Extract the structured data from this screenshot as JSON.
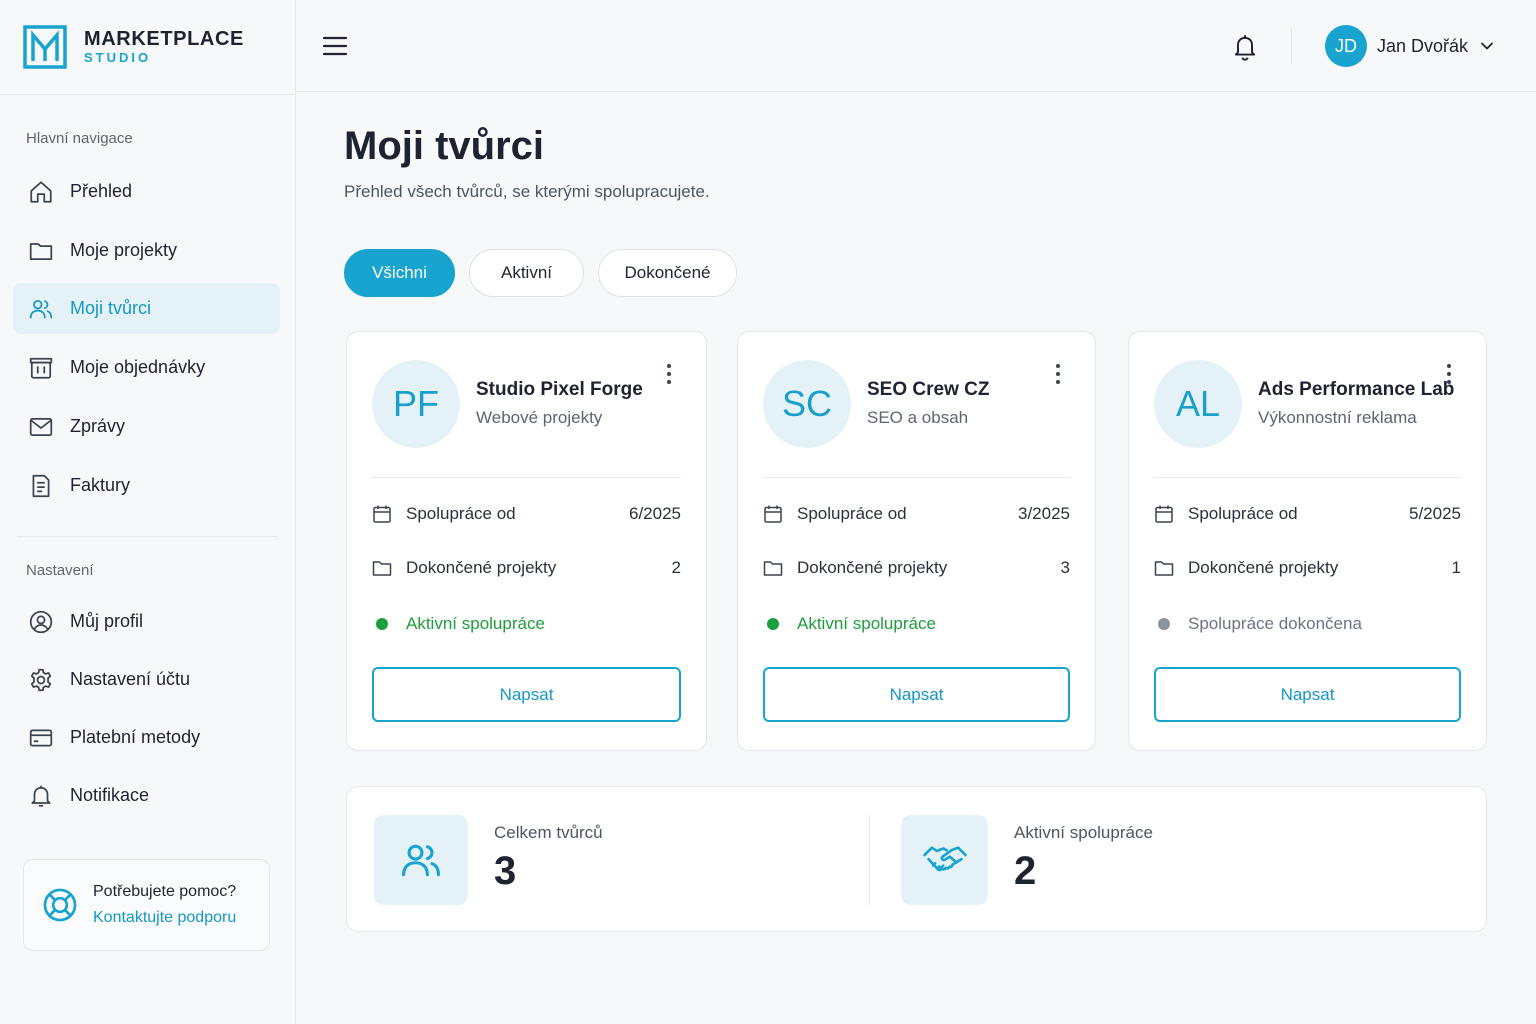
{
  "brand": {
    "title": "MARKETPLACE",
    "subtitle": "STUDIO",
    "accent": "#19a3cf"
  },
  "sidebar": {
    "section_main": "Hlavní navigace",
    "main_items": [
      {
        "label": "Přehled",
        "icon": "home-icon"
      },
      {
        "label": "Moje projekty",
        "icon": "folder-icon"
      },
      {
        "label": "Moji tvůrci",
        "icon": "users-icon",
        "active": true
      },
      {
        "label": "Moje objednávky",
        "icon": "shopping-bag-icon"
      },
      {
        "label": "Zprávy",
        "icon": "mail-icon"
      },
      {
        "label": "Faktury",
        "icon": "invoice-icon"
      }
    ],
    "section_settings": "Nastavení",
    "settings_items": [
      {
        "label": "Můj profil",
        "icon": "user-circle-icon"
      },
      {
        "label": "Nastavení účtu",
        "icon": "gear-icon"
      },
      {
        "label": "Platební metody",
        "icon": "credit-card-icon"
      },
      {
        "label": "Notifikace",
        "icon": "bell-icon"
      }
    ],
    "help": {
      "title": "Potřebujete pomoc?",
      "link": "Kontaktujte podporu",
      "icon": "lifebuoy-icon"
    }
  },
  "header": {
    "user": {
      "initials": "JD",
      "name": "Jan Dvořák"
    }
  },
  "main": {
    "title": "Moji tvůrci",
    "subtitle": "Přehled všech tvůrců, se kterými spolupracujete.",
    "filters": [
      {
        "label": "Všichni",
        "active": true
      },
      {
        "label": "Aktivní",
        "active": false
      },
      {
        "label": "Dokončené",
        "active": false
      }
    ],
    "creators": [
      {
        "initials": "PF",
        "name": "Studio Pixel Forge",
        "category": "Webové projekty",
        "since_label": "Spolupráce od",
        "since_value": "6/2025",
        "projects_label": "Dokončené projekty",
        "projects_value": "2",
        "status": "Aktivní spolupráce",
        "status_type": "active",
        "button": "Napsat"
      },
      {
        "initials": "SC",
        "name": "SEO Crew CZ",
        "category": "SEO a obsah",
        "since_label": "Spolupráce od",
        "since_value": "3/2025",
        "projects_label": "Dokončené projekty",
        "projects_value": "3",
        "status": "Aktivní spolupráce",
        "status_type": "active",
        "button": "Napsat"
      },
      {
        "initials": "AL",
        "name": "Ads Performance Lab",
        "category": "Výkonnostní reklama",
        "since_label": "Spolupráce od",
        "since_value": "5/2025",
        "projects_label": "Dokončené projekty",
        "projects_value": "1",
        "status": "Spolupráce dokončena",
        "status_type": "done",
        "button": "Napsat"
      }
    ],
    "stats": [
      {
        "label": "Celkem tvůrců",
        "value": "3",
        "icon": "users-icon"
      },
      {
        "label": "Aktivní spolupráce",
        "value": "2",
        "icon": "handshake-icon"
      }
    ]
  },
  "colors": {
    "active_status": "#1e9d3c",
    "done_status": "#8a929c"
  }
}
